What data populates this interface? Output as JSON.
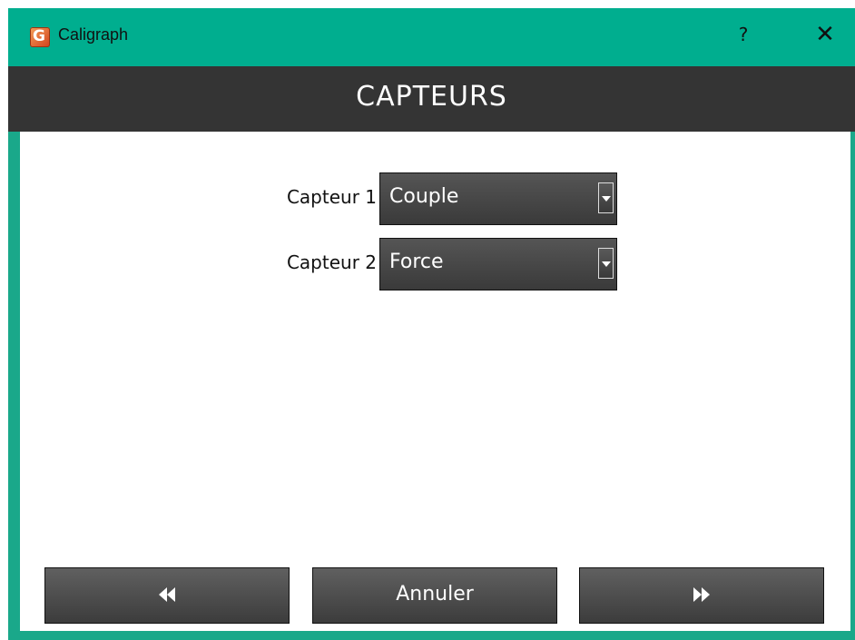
{
  "window": {
    "title": "Caligraph",
    "help_label": "?",
    "close_label": "✕"
  },
  "header": {
    "title": "CAPTEURS"
  },
  "sensors": [
    {
      "label": "Capteur 1",
      "value": "Couple"
    },
    {
      "label": "Capteur 2",
      "value": "Force"
    }
  ],
  "buttons": {
    "back_icon": "rewind-icon",
    "cancel_label": "Annuler",
    "next_icon": "fast-forward-icon"
  },
  "colors": {
    "titlebar": "#00ae8f",
    "header": "#343434",
    "button": "#4a4a4a"
  }
}
